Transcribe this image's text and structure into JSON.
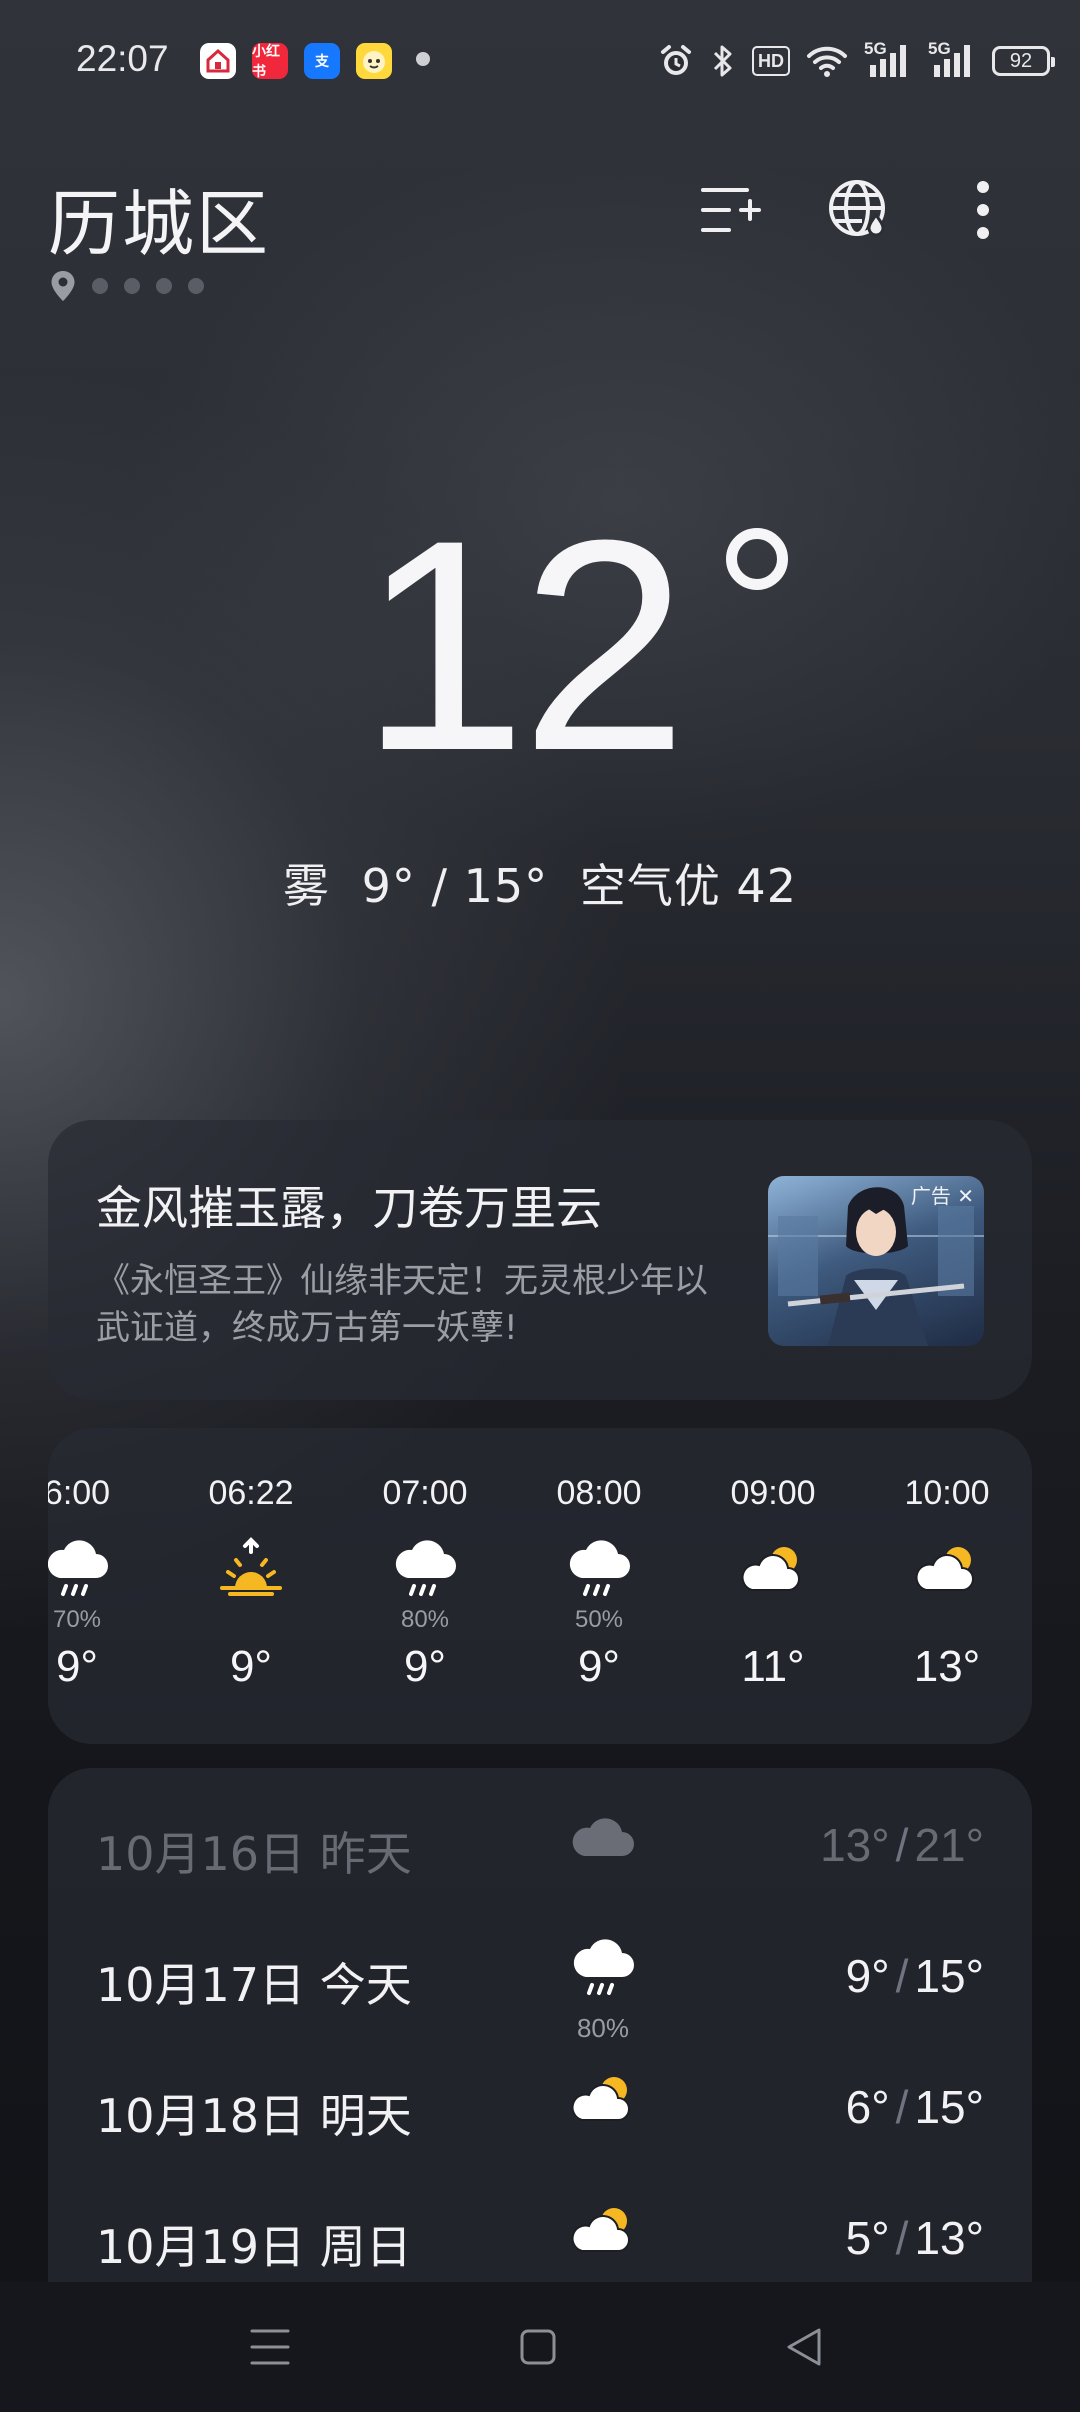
{
  "status_bar": {
    "time": "22:07",
    "apps": [
      {
        "icon": "red-house-app-icon",
        "bg": "#ffffff",
        "fg": "#d6293e",
        "label": ""
      },
      {
        "icon": "xiaohongshu-app-icon",
        "bg": "#f1273c",
        "fg": "#ffffff",
        "label": "小红书"
      },
      {
        "icon": "alipay-app-icon",
        "bg": "#1677ff",
        "fg": "#ffffff",
        "label": "支"
      },
      {
        "icon": "yellow-face-app-icon",
        "bg": "#ffd93b",
        "fg": "#7a5a00",
        "label": ""
      }
    ],
    "battery": "92",
    "network_label_1": "5G",
    "network_label_2": "5G",
    "hd_label": "HD"
  },
  "header": {
    "city": "历城区",
    "page_dots": 4
  },
  "current": {
    "temp": "12",
    "condition": "雾",
    "range": "9° / 15°",
    "aqi": "空气优 42"
  },
  "ad": {
    "title": "金风摧玉露，刀卷万里云",
    "desc": "《永恒圣王》仙缘非天定！无灵根少年以武证道，终成万古第一妖孽!",
    "tag": "广告 ✕"
  },
  "hourly": [
    {
      "time": "6:00",
      "icon": "rain-cloud-icon",
      "precip": "70%",
      "temp": "9°"
    },
    {
      "time": "06:22",
      "icon": "sunrise-icon",
      "precip": "",
      "temp": "9°"
    },
    {
      "time": "07:00",
      "icon": "rain-cloud-icon",
      "precip": "80%",
      "temp": "9°"
    },
    {
      "time": "08:00",
      "icon": "rain-cloud-icon",
      "precip": "50%",
      "temp": "9°"
    },
    {
      "time": "09:00",
      "icon": "partly-cloudy-icon",
      "precip": "",
      "temp": "11°"
    },
    {
      "time": "10:00",
      "icon": "partly-cloudy-icon",
      "precip": "",
      "temp": "13°"
    }
  ],
  "daily": [
    {
      "date": "10月16日  昨天",
      "icon": "cloud-icon",
      "precip": "",
      "low": "13°",
      "high": "21°",
      "dim": true
    },
    {
      "date": "10月17日  今天",
      "icon": "rain-cloud-icon",
      "precip": "80%",
      "low": "9°",
      "high": "15°",
      "dim": false
    },
    {
      "date": "10月18日  明天",
      "icon": "partly-cloudy-icon",
      "precip": "",
      "low": "6°",
      "high": "15°",
      "dim": false
    },
    {
      "date": "10月19日  周日",
      "icon": "partly-cloudy-icon",
      "precip": "",
      "low": "5°",
      "high": "13°",
      "dim": false
    }
  ],
  "colors": {
    "sun": "#f5b722",
    "cloud": "#ffffff",
    "dim_cloud": "#6a6d75"
  }
}
